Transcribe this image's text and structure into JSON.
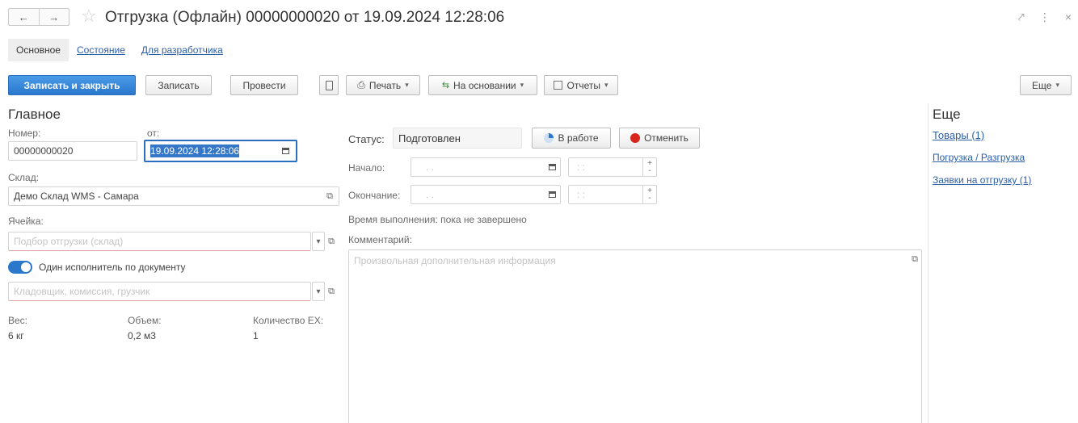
{
  "header": {
    "back_icon": "←",
    "forward_icon": "→",
    "title": "Отгрузка (Офлайн) 00000000020 от 19.09.2024 12:28:06",
    "window_icons": {
      "link": "⤤",
      "more": "⋮",
      "close": "×"
    }
  },
  "tabs": [
    {
      "label": "Основное",
      "active": true
    },
    {
      "label": "Состояние",
      "active": false
    },
    {
      "label": "Для разработчика",
      "active": false
    }
  ],
  "toolbar": {
    "save_close": "Записать и закрыть",
    "save": "Записать",
    "post": "Провести",
    "print": "Печать",
    "based_on": "На основании",
    "reports": "Отчеты",
    "more": "Еще"
  },
  "main": {
    "section_title": "Главное",
    "number_label": "Номер:",
    "number_value": "00000000020",
    "date_label": "от:",
    "date_value": "19.09.2024 12:28:06",
    "warehouse_label": "Склад:",
    "warehouse_value": "Демо Склад WMS - Самара",
    "cell_label": "Ячейка:",
    "cell_placeholder": "Подбор отгрузки (склад)",
    "single_executor_label": "Один исполнитель по документу",
    "executor_placeholder": "Кладовщик, комиссия, грузчик",
    "weight_label": "Вес:",
    "weight_value": "6 кг",
    "volume_label": "Объем:",
    "volume_value": "0,2 м3",
    "qty_label": "Количество ЕХ:",
    "qty_value": "1"
  },
  "status": {
    "status_label": "Статус:",
    "status_value": "Подготовлен",
    "in_work_button": "В работе",
    "cancel_button": "Отменить",
    "start_label": "Начало:",
    "start_date_placeholder": ". .",
    "start_time_placeholder": ": :",
    "end_label": "Окончание:",
    "end_date_placeholder": ". .",
    "end_time_placeholder": ": :",
    "duration_text": "Время выполнения: пока не завершено",
    "comment_label": "Комментарий:",
    "comment_placeholder": "Произвольная дополнительная информация"
  },
  "side": {
    "title": "Еще",
    "links": [
      "Товары (1)",
      "Погрузка / Разгрузка",
      "Заявки на отгрузку (1)"
    ]
  },
  "colors": {
    "accent": "#2a77cc",
    "link": "#2b5fa8",
    "cancel_dot": "#d9261c"
  }
}
